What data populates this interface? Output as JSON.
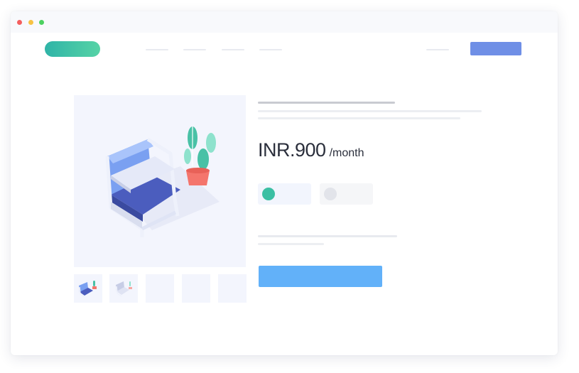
{
  "window": {
    "controls": [
      "close",
      "minimize",
      "maximize"
    ],
    "control_colors": {
      "close": "#f45e5e",
      "minimize": "#f7c244",
      "maximize": "#4cd160"
    }
  },
  "colors": {
    "logo_gradient": [
      "#2fb4a7",
      "#56d3a6"
    ],
    "nav_cta": "#6f8fe6",
    "primary_button": "#62b1f9",
    "image_background": "#f3f5fd",
    "swatch_selected": "#3bbfa3",
    "swatch_unselected": "#e2e4ea"
  },
  "product": {
    "price_amount": "INR.900",
    "price_period": "/month",
    "gallery_thumbnail_count": 5,
    "color_options": [
      "teal",
      "gray"
    ],
    "selected_color": "teal"
  },
  "icons": {
    "main_image": "armchair-with-plant-illustration",
    "thumbnail_1": "armchair-illustration",
    "thumbnail_2": "armchair-illustration"
  }
}
